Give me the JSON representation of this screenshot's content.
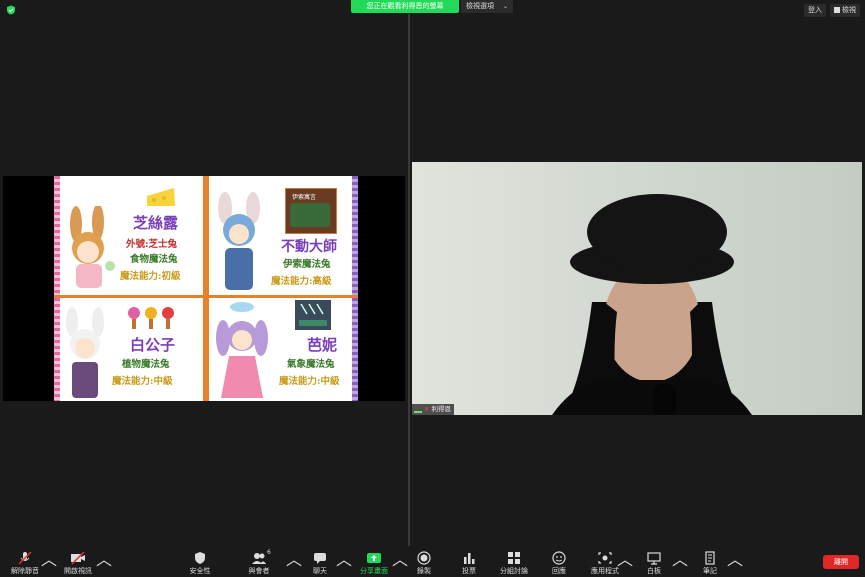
{
  "topbar": {
    "viewing_banner": "您正在觀看利得恩的螢幕",
    "view_options": "檢視選項",
    "signin": "登入",
    "view_mode": "檢視"
  },
  "slide": {
    "cards": [
      {
        "name": "芝絲露",
        "lines": [
          "外號:芝士兔",
          "食物魔法兔",
          "魔法能力:初級"
        ]
      },
      {
        "name": "不動大師",
        "lines": [
          "伊索魔法兔",
          "魔法能力:高級"
        ],
        "book_label": "伊索寓言"
      },
      {
        "name": "白公子",
        "lines": [
          "植物魔法兔",
          "魔法能力:中級"
        ]
      },
      {
        "name": "芭妮",
        "lines": [
          "氣象魔法兔",
          "魔法能力:中級"
        ]
      }
    ]
  },
  "video": {
    "participant_name": "利得恩"
  },
  "toolbar": {
    "items": [
      {
        "label": "解除靜音",
        "icon": "mic-muted-icon"
      },
      {
        "label": "開啟視訊",
        "icon": "video-off-icon"
      },
      {
        "label": "安全性",
        "icon": "shield-icon"
      },
      {
        "label": "與會者",
        "icon": "participants-icon",
        "badge": "6"
      },
      {
        "label": "聊天",
        "icon": "chat-icon"
      },
      {
        "label": "分享畫面",
        "icon": "share-screen-icon"
      },
      {
        "label": "錄製",
        "icon": "record-icon"
      },
      {
        "label": "投票",
        "icon": "poll-icon"
      },
      {
        "label": "分組討論",
        "icon": "breakout-icon"
      },
      {
        "label": "回應",
        "icon": "reaction-icon"
      },
      {
        "label": "應用程式",
        "icon": "apps-icon"
      },
      {
        "label": "白板",
        "icon": "whiteboard-icon"
      },
      {
        "label": "筆記",
        "icon": "notes-icon"
      }
    ],
    "end_label": "離開"
  },
  "colors": {
    "accent_green": "#23d959",
    "end_red": "#e02828",
    "share_green": "#23d959"
  }
}
